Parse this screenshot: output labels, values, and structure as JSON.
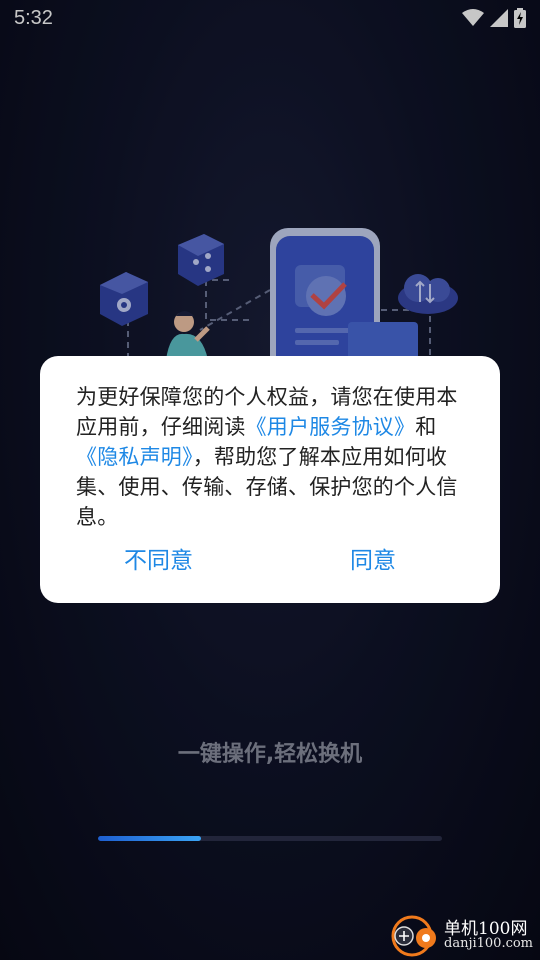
{
  "status_bar": {
    "time": "5:32",
    "icons": [
      "wifi-icon",
      "signal-icon",
      "battery-charging-icon"
    ]
  },
  "dialog": {
    "message_parts": {
      "p1": "为更好保障您的个人权益，请您在使用本应用前，仔细阅读",
      "link1": "《用户服务协议》",
      "p2": "和",
      "link2": "《隐私声明》",
      "p3": "，帮助您了解本应用如何收集、使用、传输、存储、保护您的个人信息。"
    },
    "disagree_label": "不同意",
    "agree_label": "同意"
  },
  "slogan": "一键操作,轻松换机",
  "progress": {
    "fraction": 0.3
  },
  "watermark": {
    "title": "单机100网",
    "url": "danji100.com"
  },
  "colors": {
    "accent": "#1e88e5",
    "background": "#10142a",
    "dialog_bg": "#ffffff",
    "progress_fill": "#2f86e8"
  }
}
